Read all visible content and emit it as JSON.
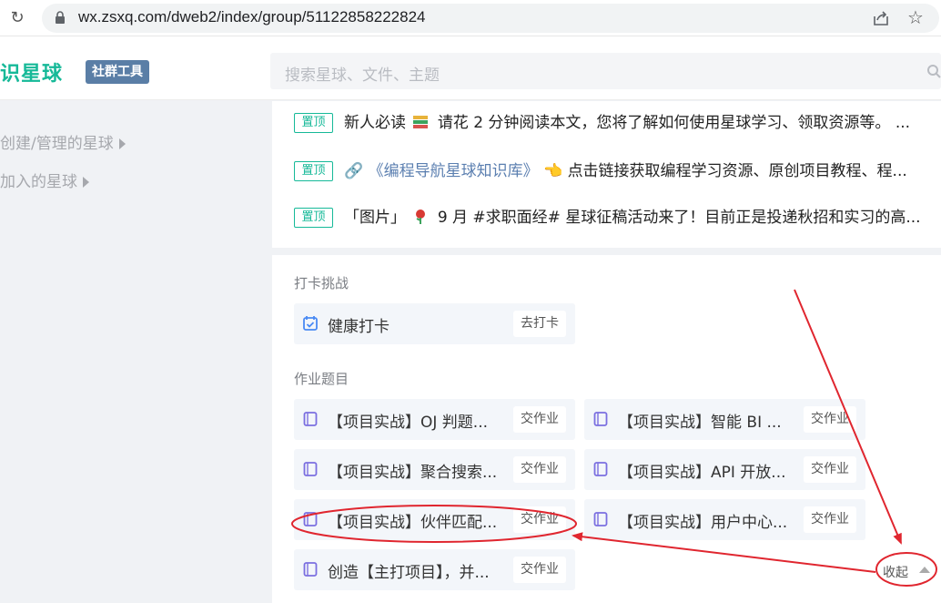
{
  "browser": {
    "url": "wx.zsxq.com/dweb2/index/group/51122858222824"
  },
  "header": {
    "logo": "识星球",
    "badge": "社群工具",
    "search_placeholder": "搜索星球、文件、主题"
  },
  "sidebar": {
    "items": [
      {
        "label": "创建/管理的星球"
      },
      {
        "label": "加入的星球"
      }
    ]
  },
  "pinned": {
    "tag": "置顶",
    "items": [
      {
        "before": "新人必读",
        "icon": "book-emoji",
        "after": "请花 2 分钟阅读本文，您将了解如何使用星球学习、领取资源等。 ..."
      },
      {
        "before": "",
        "link": "《编程导航星球知识库》",
        "icon": "pointing-hand-emoji",
        "after": "点击链接获取编程学习资源、原创项目教程、程..."
      },
      {
        "before": "「图片」",
        "icon": "rose-emoji",
        "after": "9 月 #求职面经# 星球征稿活动来了！目前正是投递秋招和实习的高..."
      }
    ]
  },
  "checkin": {
    "section_title": "打卡挑战",
    "items": [
      {
        "label": "健康打卡",
        "button": "去打卡"
      }
    ]
  },
  "homework": {
    "section_title": "作业题目",
    "items": [
      {
        "label": "【项目实战】OJ 判题...",
        "button": "交作业"
      },
      {
        "label": "【项目实战】智能 BI ...",
        "button": "交作业"
      },
      {
        "label": "【项目实战】聚合搜索...",
        "button": "交作业"
      },
      {
        "label": "【项目实战】API 开放...",
        "button": "交作业"
      },
      {
        "label": "【项目实战】伙伴匹配...",
        "button": "交作业"
      },
      {
        "label": "【项目实战】用户中心...",
        "button": "交作业"
      },
      {
        "label": "创造【主打项目】，并...",
        "button": "交作业"
      }
    ]
  },
  "collapse_label": "收起",
  "colors": {
    "brand": "#16b998",
    "badge": "#5a7ea6",
    "annotation": "#e0262f"
  }
}
